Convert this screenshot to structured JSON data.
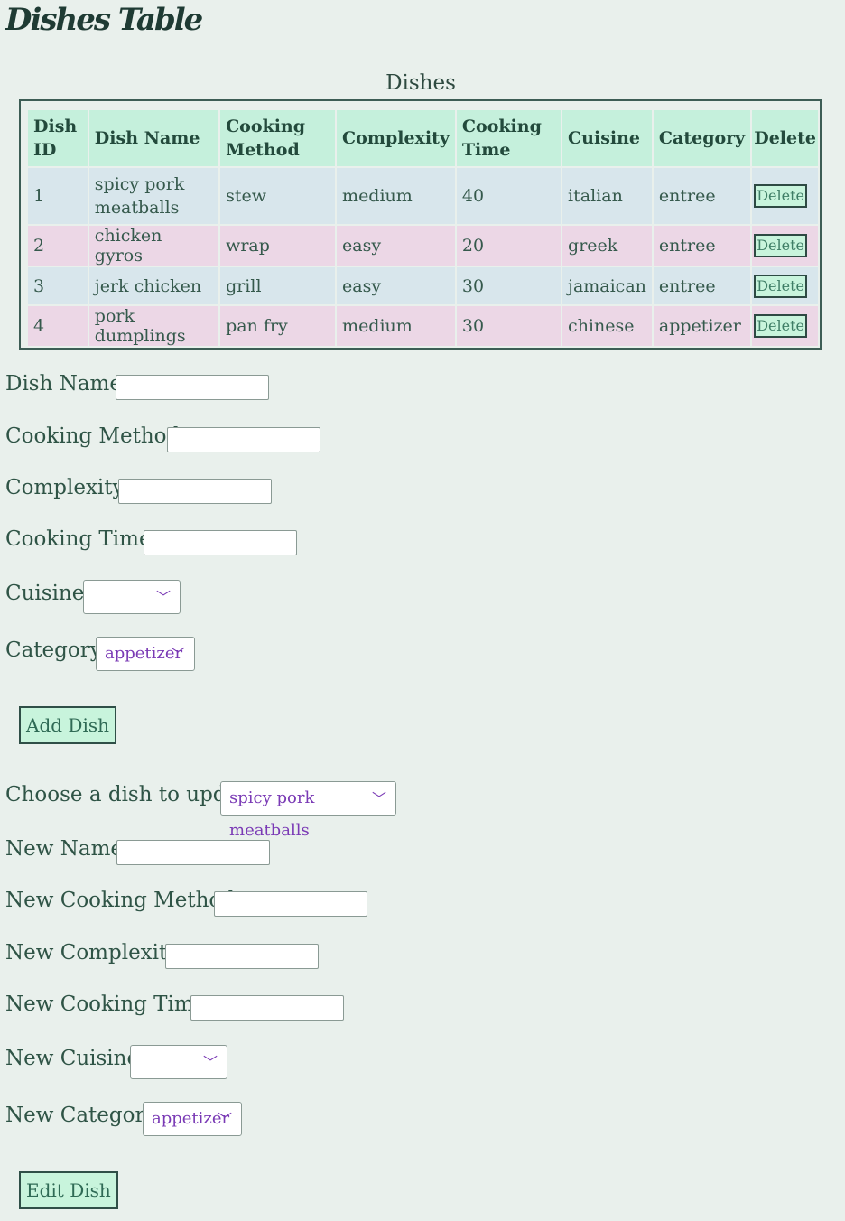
{
  "header": {
    "title": "Dishes Table"
  },
  "table": {
    "caption": "Dishes",
    "columns": [
      {
        "l1": "Dish",
        "l2": "ID"
      },
      {
        "l1": "Dish Name",
        "l2": ""
      },
      {
        "l1": "Cooking",
        "l2": "Method"
      },
      {
        "l1": "Complexity",
        "l2": ""
      },
      {
        "l1": "Cooking",
        "l2": "Time"
      },
      {
        "l1": "Cuisine",
        "l2": ""
      },
      {
        "l1": "Category",
        "l2": ""
      },
      {
        "l1": "Delete",
        "l2": ""
      }
    ],
    "rows": [
      {
        "id": "1",
        "name": "spicy pork meatballs",
        "method": "stew",
        "complexity": "medium",
        "time": "40",
        "cuisine": "italian",
        "category": "entree",
        "delete_label": "Delete"
      },
      {
        "id": "2",
        "name": "chicken gyros",
        "method": "wrap",
        "complexity": "easy",
        "time": "20",
        "cuisine": "greek",
        "category": "entree",
        "delete_label": "Delete"
      },
      {
        "id": "3",
        "name": "jerk chicken",
        "method": "grill",
        "complexity": "easy",
        "time": "30",
        "cuisine": "jamaican",
        "category": "entree",
        "delete_label": "Delete"
      },
      {
        "id": "4",
        "name": "pork dumplings",
        "method": "pan fry",
        "complexity": "medium",
        "time": "30",
        "cuisine": "chinese",
        "category": "appetizer",
        "delete_label": "Delete"
      }
    ]
  },
  "add_form": {
    "dish_name_label": "Dish Name:",
    "cooking_method_label": "Cooking Method:",
    "complexity_label": "Complexity:",
    "cooking_time_label": "Cooking Time:",
    "cuisine_label": "Cuisine:",
    "cuisine_value": "",
    "category_label": "Category:",
    "category_value": "appetizer",
    "submit_label": "Add Dish"
  },
  "edit_form": {
    "choose_label": "Choose a dish to update:",
    "choose_value": "spicy pork meatballs",
    "new_name_label": "New Name:",
    "new_method_label": "New Cooking Method:",
    "new_complexity_label": "New Complexity:",
    "new_time_label": "New Cooking Time:",
    "new_cuisine_label": "New Cuisine:",
    "new_cuisine_value": "",
    "new_category_label": "New Category:",
    "new_category_value": "appetizer",
    "submit_label": "Edit Dish"
  },
  "icons": {
    "dropdown": "chevron-down-icon"
  }
}
